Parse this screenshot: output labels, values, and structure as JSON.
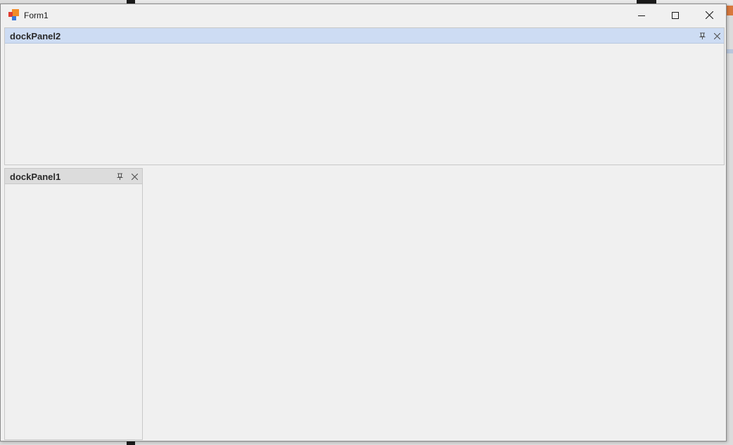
{
  "window": {
    "title": "Form1"
  },
  "dock_panel_top": {
    "title": "dockPanel2",
    "active": true
  },
  "dock_panel_left": {
    "title": "dockPanel1",
    "active": false
  },
  "colors": {
    "active_header": "#cddcf3",
    "inactive_header": "#dcdcdc",
    "window_background": "#f0f0f0"
  },
  "icons": {
    "app": "app-icon",
    "minimize": "minimize-icon",
    "maximize": "maximize-icon",
    "close": "close-icon",
    "pin": "pin-icon",
    "panel_close": "close-icon"
  }
}
